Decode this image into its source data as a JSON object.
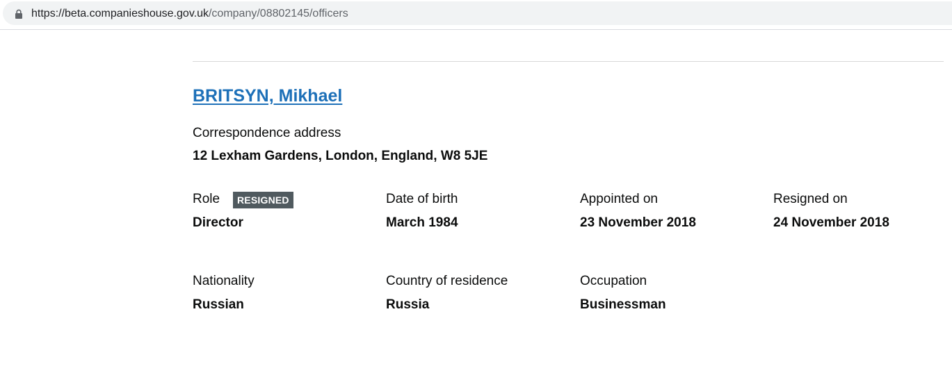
{
  "browser": {
    "url_host": "https://beta.companieshouse.gov.uk",
    "url_path": "/company/08802145/officers",
    "lock_icon": "lock-icon"
  },
  "officer": {
    "name": "BRITSYN, Mikhael",
    "correspondence_address_label": "Correspondence address",
    "correspondence_address": "12 Lexham Gardens, London, England, W8 5JE",
    "role_label": "Role",
    "status_badge": "RESIGNED",
    "role": "Director",
    "dob_label": "Date of birth",
    "dob": "March 1984",
    "appointed_label": "Appointed on",
    "appointed": "23 November 2018",
    "resigned_label": "Resigned on",
    "resigned": "24 November 2018",
    "nationality_label": "Nationality",
    "nationality": "Russian",
    "residence_label": "Country of residence",
    "residence": "Russia",
    "occupation_label": "Occupation",
    "occupation": "Businessman"
  },
  "colors": {
    "link": "#1d70b8",
    "badge_bg": "#505a5f",
    "address_bar_bg": "#f1f3f4"
  }
}
